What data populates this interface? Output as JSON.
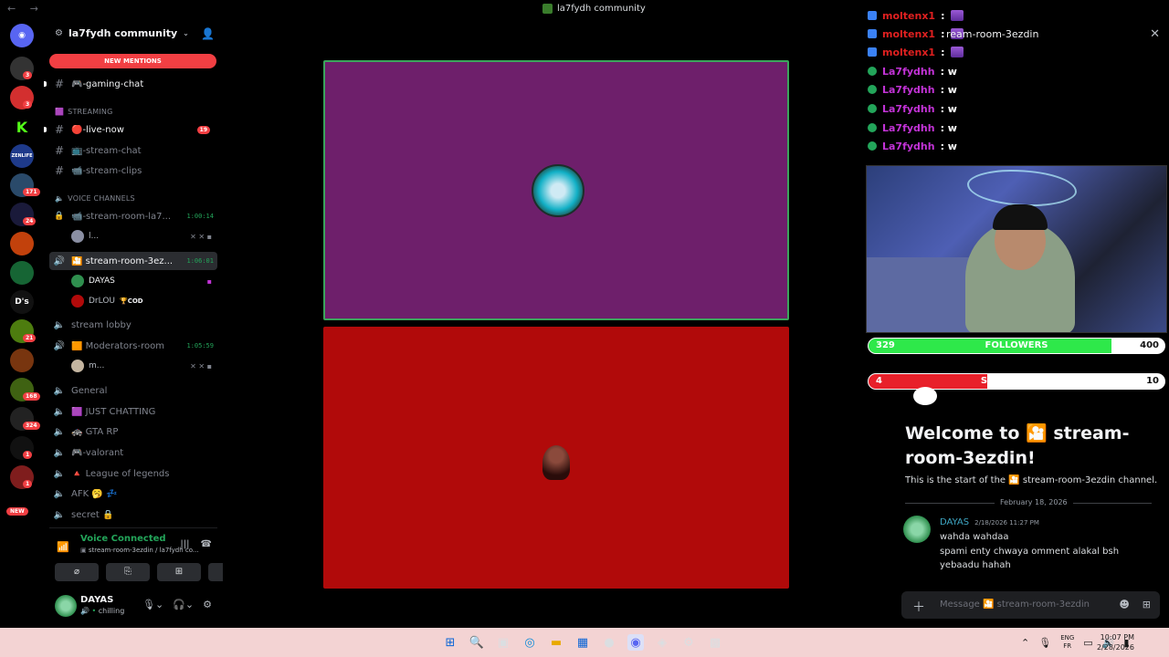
{
  "window": {
    "title": "la7fydh community",
    "nav": "← →",
    "controls": {
      "inbox": "▢",
      "help": "?",
      "minimize": "—",
      "maximize": "☐",
      "close": "✕"
    }
  },
  "rail": {
    "discord_home": "◉",
    "servers": [
      {
        "label": "",
        "badge": "3"
      },
      {
        "label": "",
        "badge": "3"
      },
      {
        "label": "K",
        "badge": ""
      },
      {
        "label": "ZENLIFE",
        "badge": ""
      },
      {
        "label": "",
        "badge": "171"
      },
      {
        "label": "",
        "badge": "24"
      },
      {
        "label": "",
        "badge": ""
      },
      {
        "label": "",
        "badge": ""
      },
      {
        "label": "D's",
        "badge": ""
      },
      {
        "label": "",
        "badge": "21"
      },
      {
        "label": "",
        "badge": ""
      },
      {
        "label": "",
        "badge": "168"
      },
      {
        "label": "",
        "badge": "324"
      },
      {
        "label": "",
        "badge": "1"
      },
      {
        "label": "",
        "badge": "1"
      }
    ],
    "new_badge": "NEW"
  },
  "sidebar": {
    "server_name": "la7fydh community",
    "new_mentions": "NEW MENTIONS",
    "gaming_chat": "🎮-gaming-chat",
    "cat_streaming": "STREAMING",
    "live_now": "🔴-live-now",
    "live_now_count": "19",
    "stream_chat": "📺-stream-chat",
    "stream_clips": "📹-stream-clips",
    "cat_voice": "VOICE CHANNELS",
    "room1": "📹-stream-room-la7...",
    "room1_timer": "1:00:14",
    "room1_user": "l...",
    "room2": "🎦 stream-room-3ez...",
    "room2_timer": "1:06:01",
    "room2_user1": "DAYAS",
    "room2_user2": "DrLOU",
    "room2_user2_tag": "🏆COD",
    "stream_lobby": "stream lobby",
    "mods_room": "🟧 Moderators-room",
    "mods_timer": "1:05:59",
    "mods_user": "m...",
    "general": "General",
    "just_chatting": "🟪 JUST CHATTING",
    "gta_rp": "🚓 GTA RP",
    "valorant": "🎮-valorant",
    "lol": "🔺 League of legends",
    "afk": "AFK 🥱 💤",
    "secret": "secret 🔒"
  },
  "voice": {
    "status": "Voice Connected",
    "channel_path": "stream-room-3ezdin / la7fydh co..."
  },
  "user": {
    "name": "DAYAS",
    "status": "chilling"
  },
  "right_panel": {
    "chat": [
      {
        "name": "moltenx1",
        "text": "",
        "color": "red",
        "emote": true,
        "icon": "twitch"
      },
      {
        "name": "moltenx1",
        "text": "",
        "color": "red",
        "emote": true,
        "icon": "twitch"
      },
      {
        "name": "moltenx1",
        "text": "",
        "color": "red",
        "emote": true,
        "icon": "twitch"
      },
      {
        "name": "La7fydhh",
        "text": ": w",
        "color": "pur",
        "emote": false,
        "icon": "dot"
      },
      {
        "name": "La7fydhh",
        "text": ": w",
        "color": "pur",
        "emote": false,
        "icon": "dot"
      },
      {
        "name": "La7fydhh",
        "text": ": w",
        "color": "pur",
        "emote": false,
        "icon": "dot"
      },
      {
        "name": "La7fydhh",
        "text": ": w",
        "color": "pur",
        "emote": false,
        "icon": "dot"
      },
      {
        "name": "La7fydhh",
        "text": ": w",
        "color": "pur",
        "emote": false,
        "icon": "dot"
      }
    ],
    "popout_title": "ream-room-3ezdin",
    "followers": {
      "current": "329",
      "label": "FOLLOWERS",
      "goal": "400",
      "progress": 0.82
    },
    "subscribers": {
      "current": "4",
      "label": "SUBSCRIBERS",
      "goal": "10",
      "progress": 0.4
    },
    "welcome_title": "Welcome to 🎦 stream-room-3ezdin!",
    "welcome_sub": "This is the start of the 🎦 stream-room-3ezdin channel.",
    "date_divider": "February 18, 2026",
    "message": {
      "author": "DAYAS",
      "time": "2/18/2026 11:27 PM",
      "line1": "wahda wahdaa",
      "line2": "spami enty chwaya omment alakal bsh yebaadu hahah"
    },
    "composer_placeholder": "Message 🎦 stream-room-3ezdin"
  },
  "taskbar": {
    "lang_top": "ENG",
    "lang_bottom": "FR",
    "time": "10:07 PM",
    "date": "2/28/2026"
  },
  "colors": {
    "green": "#23a55a",
    "red": "#f23f43",
    "tile_purple": "#6e1f6b",
    "tile_red": "#b10a0a",
    "followers_fill": "#2ee84a",
    "subscribers_fill": "#e8202a"
  }
}
